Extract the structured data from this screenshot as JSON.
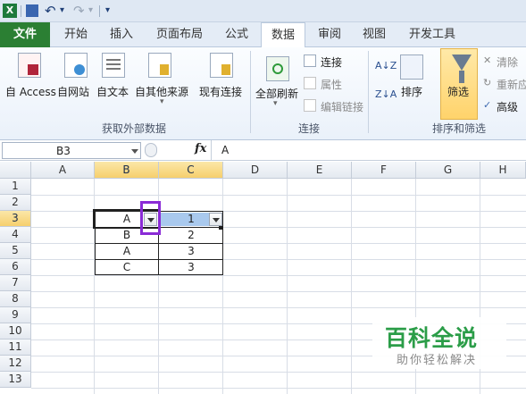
{
  "qat": {
    "logo": "X",
    "undo": "↶",
    "redo": "↷",
    "more": "▾"
  },
  "tabs": [
    "文件",
    "开始",
    "插入",
    "页面布局",
    "公式",
    "数据",
    "审阅",
    "视图",
    "开发工具"
  ],
  "active_tab": "数据",
  "ribbon": {
    "external": [
      "自 Access",
      "自网站",
      "自文本",
      "自其他来源",
      "现有连接"
    ],
    "group_external": "获取外部数据",
    "refresh_all": "全部刷新",
    "connections": "连接",
    "properties": "属性",
    "edit_links": "编辑链接",
    "group_connections": "连接",
    "sort_az": "A↓Z",
    "sort_za": "Z↓A",
    "sort": "排序",
    "filter": "筛选",
    "clear": "清除",
    "reapply": "重新应",
    "advanced": "高级",
    "group_sort_filter": "排序和筛选"
  },
  "formula_bar": {
    "name_box": "B3",
    "fx": "fx",
    "value": "A"
  },
  "columns": [
    "A",
    "B",
    "C",
    "D",
    "E",
    "F",
    "G",
    "H"
  ],
  "rows": [
    "1",
    "2",
    "3",
    "4",
    "5",
    "6",
    "7",
    "8",
    "9",
    "10",
    "11",
    "12",
    "13"
  ],
  "cells": {
    "b3": "A",
    "c3": "1",
    "b4": "B",
    "c4": "2",
    "b5": "A",
    "c5": "3",
    "b6": "C",
    "c6": "3"
  },
  "watermark": {
    "title": "百科全说",
    "subtitle": "助你轻松解决"
  },
  "colors": {
    "file_tab": "#2b7f33",
    "selected_header": "#f6cf6d",
    "highlight_box": "#8a2bd6",
    "watermark": "#2b9d48"
  }
}
